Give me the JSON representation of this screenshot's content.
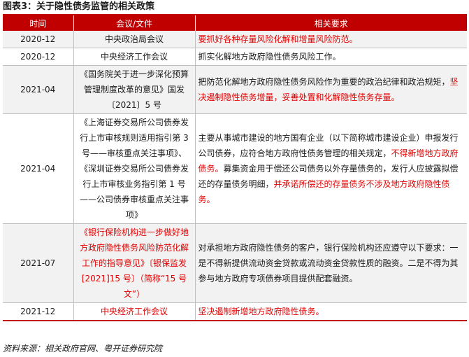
{
  "figure": {
    "title": "图表3：关于隐性债务监管的相关政策",
    "source": "资料来源：相关政府官网、粤开证券研究院"
  },
  "table": {
    "headers": [
      "时间",
      "会议/文件",
      "相关要求"
    ],
    "rows": [
      {
        "date": "2020-12",
        "doc": [
          {
            "t": "中央政治局会议",
            "red": false
          }
        ],
        "req": [
          {
            "t": "要抓好各种存量风险化解和增量风险防范。",
            "red": true
          }
        ]
      },
      {
        "date": "2020-12",
        "doc": [
          {
            "t": "中央经济工作会议",
            "red": false
          }
        ],
        "req": [
          {
            "t": "抓实化解地方政府隐性债务风险工作。",
            "red": false
          }
        ]
      },
      {
        "date": "2021-04",
        "doc": [
          {
            "t": "《国务院关于进一步深化预算管理制度改革的意见》国发〔2021〕5 号",
            "red": false
          }
        ],
        "req": [
          {
            "t": "把防范化解地方政府隐性债务风险作为重要的政治纪律和政治规矩，",
            "red": false
          },
          {
            "t": "坚决遏制隐性债务增量，妥善处置和化解隐性债务存量。",
            "red": true
          }
        ]
      },
      {
        "date": "2021-04",
        "doc": [
          {
            "t": "《上海证券交易所公司债券发行上市审核规则适用指引第 3 号——审核重点关注事项》、《深圳证券交易所公司债券发行上市审核业务指引第 1 号——公司债券审核重点关注事项》",
            "red": false
          }
        ],
        "req": [
          {
            "t": "主要从事城市建设的地方国有企业（以下简称城市建设企业）申报发行公司债券，应符合地方政府性债务管理的相关规定，",
            "red": false
          },
          {
            "t": "不得新增地方政府债务。",
            "red": true
          },
          {
            "t": "募集资金用于偿还公司债务以外存量债务的，发行人应披露拟偿还的存量债务明细，",
            "red": false
          },
          {
            "t": "并承诺所偿还的存量债务不涉及地方政府隐性债务。",
            "red": true
          }
        ]
      },
      {
        "date": "2021-07",
        "doc": [
          {
            "t": "《银行保险机构进一步做好地方政府隐性债务风险防范化解工作的指导意见》〔银保监发[2021]15 号〕（简称“15 号文”）",
            "red": true
          }
        ],
        "req": [
          {
            "t": "对承担地方政府隐性债务的客户，银行保险机构还应遵守以下要求：一是不得新提供流动资金贷款或流动资金贷款性质的融资。二是不得为其参与地方政府专项债券项目提供配套融资。",
            "red": false
          }
        ]
      },
      {
        "date": "2021-12",
        "doc": [
          {
            "t": "中央经济工作会议",
            "red": true
          }
        ],
        "req": [
          {
            "t": "坚决遏制新增地方政府隐性债务。",
            "red": true
          }
        ]
      }
    ]
  }
}
